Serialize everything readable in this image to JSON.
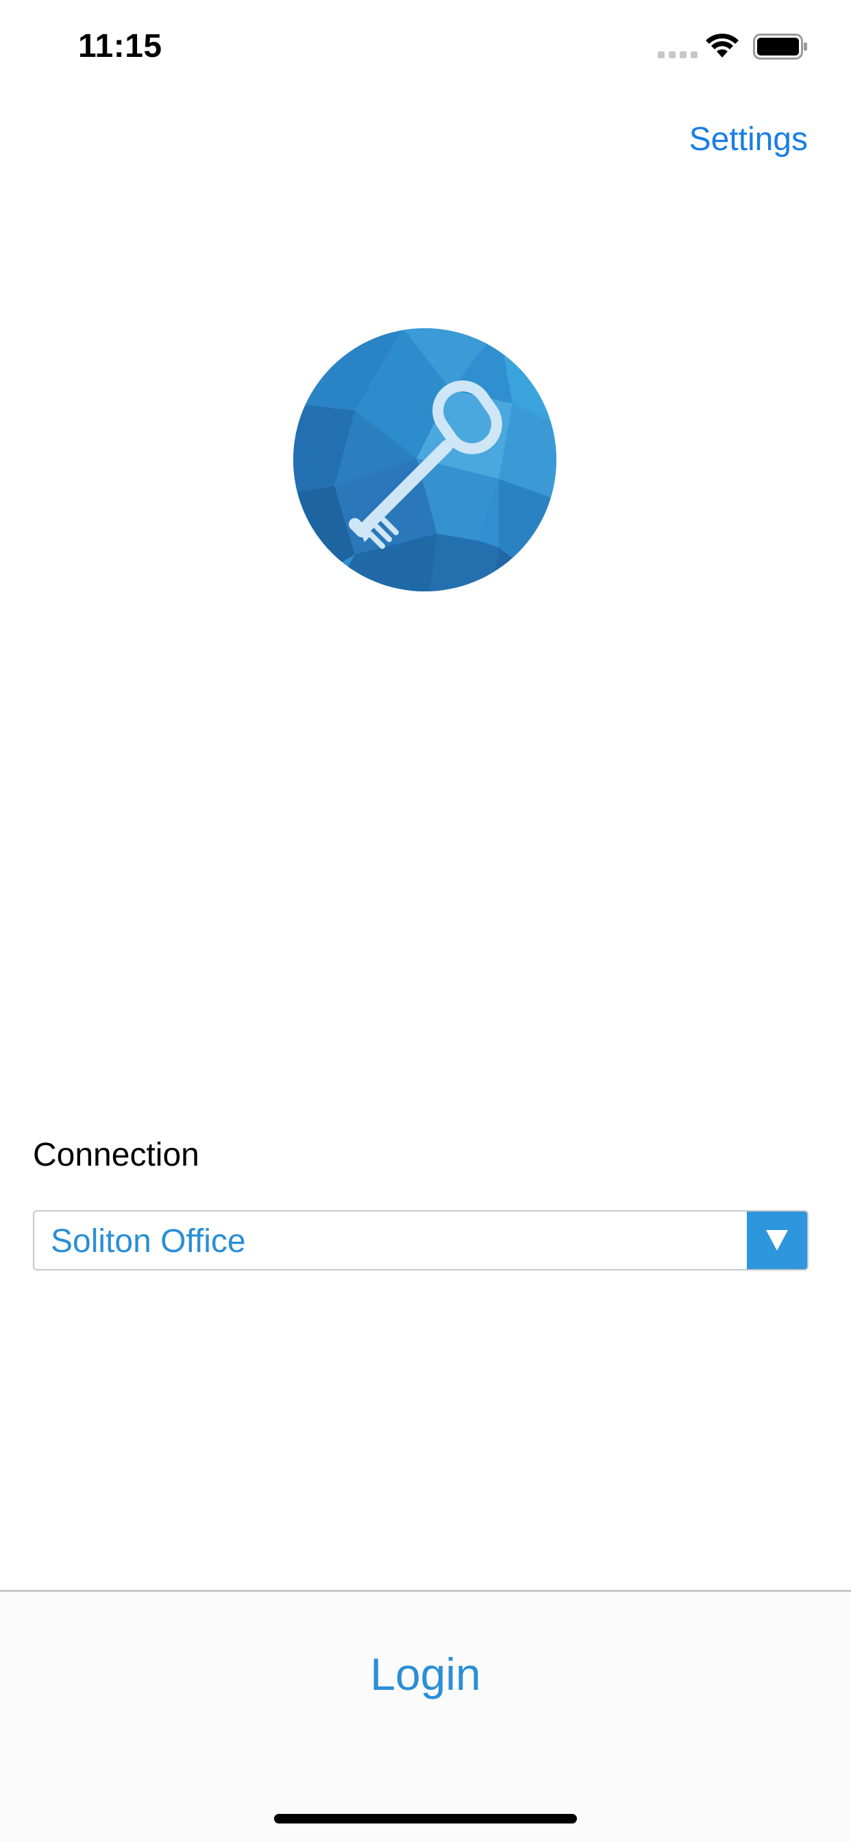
{
  "status_bar": {
    "time": "11:15",
    "signal_icon": "signal-dots-icon",
    "wifi_icon": "wifi-icon",
    "battery_icon": "battery-icon"
  },
  "nav": {
    "settings_label": "Settings"
  },
  "logo": {
    "icon": "key-icon",
    "colors": {
      "primary": "#2f8fcf",
      "dark": "#1f6aa6",
      "light": "#4aa8de",
      "key": "#cfe6f6"
    }
  },
  "connection": {
    "label": "Connection",
    "selected": "Soliton Office",
    "dropdown_icon": "triangle-down-icon"
  },
  "footer": {
    "login_label": "Login"
  },
  "colors": {
    "accent": "#1a7ee6",
    "link": "#2a8fd6",
    "dropdown_bg": "#2e96dc"
  }
}
